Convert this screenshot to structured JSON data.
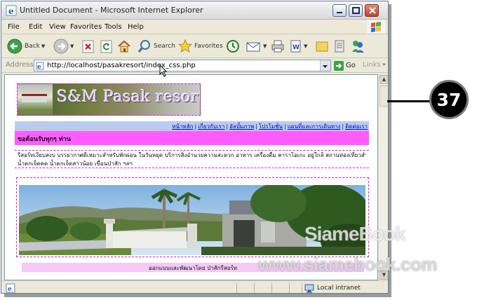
{
  "window": {
    "title": "Untitled Document - Microsoft Internet Explorer"
  },
  "menu": {
    "items": [
      "File",
      "Edit",
      "View",
      "Favorites",
      "Tools",
      "Help"
    ]
  },
  "toolbar": {
    "back_label": "Back",
    "search_label": "Search",
    "favorites_label": "Favorites"
  },
  "address": {
    "label": "Address",
    "url": "http://localhost/pasakresort/index_css.php",
    "go_label": "Go",
    "links_label": "Links"
  },
  "page": {
    "banner_text": "S&M Pasak resort",
    "nav_links": [
      "หน้าหลัก",
      "เกี่ยวกับเรา",
      "อัลบั้มภาพ",
      "โปรโมชั่น",
      "แผนที่และการเดินทาง",
      "ติดต่อเรา"
    ],
    "welcome": "ขอต้อนรับทุกๆ ท่าน",
    "intro_line1": "รีสอร์ทเงียบสงบ บรรยากาศดีเหมาะสำหรับพักผ่อน ในวันหยุด บริการสิ่งอำนวยความสะดวก อาหาร เครื่องดื่ม คาราโอเกะ อยู่ใกล้ สถานท่องเที่ยวสำคัญ เช่น ไร่องุ่น",
    "intro_line2": "น้ำตกเจ็ดคด น้ำตกเจ็ดสาวน้อย เขื่อนป่าสัก ฯลฯ",
    "footer": "ออกแบบและพัฒนาโดย ป่าสักรีสอร์ท"
  },
  "status": {
    "zone": "Local intranet"
  },
  "callout": {
    "number": "37"
  },
  "watermark": {
    "line1": "SiameBook",
    "line2": "www.siamebook.com"
  },
  "colors": {
    "nav_bg": "#b9ccee",
    "welcome_bg": "#ff5cff",
    "dashed_border": "#d21dd2",
    "footer_bg": "#f5c8f5"
  }
}
